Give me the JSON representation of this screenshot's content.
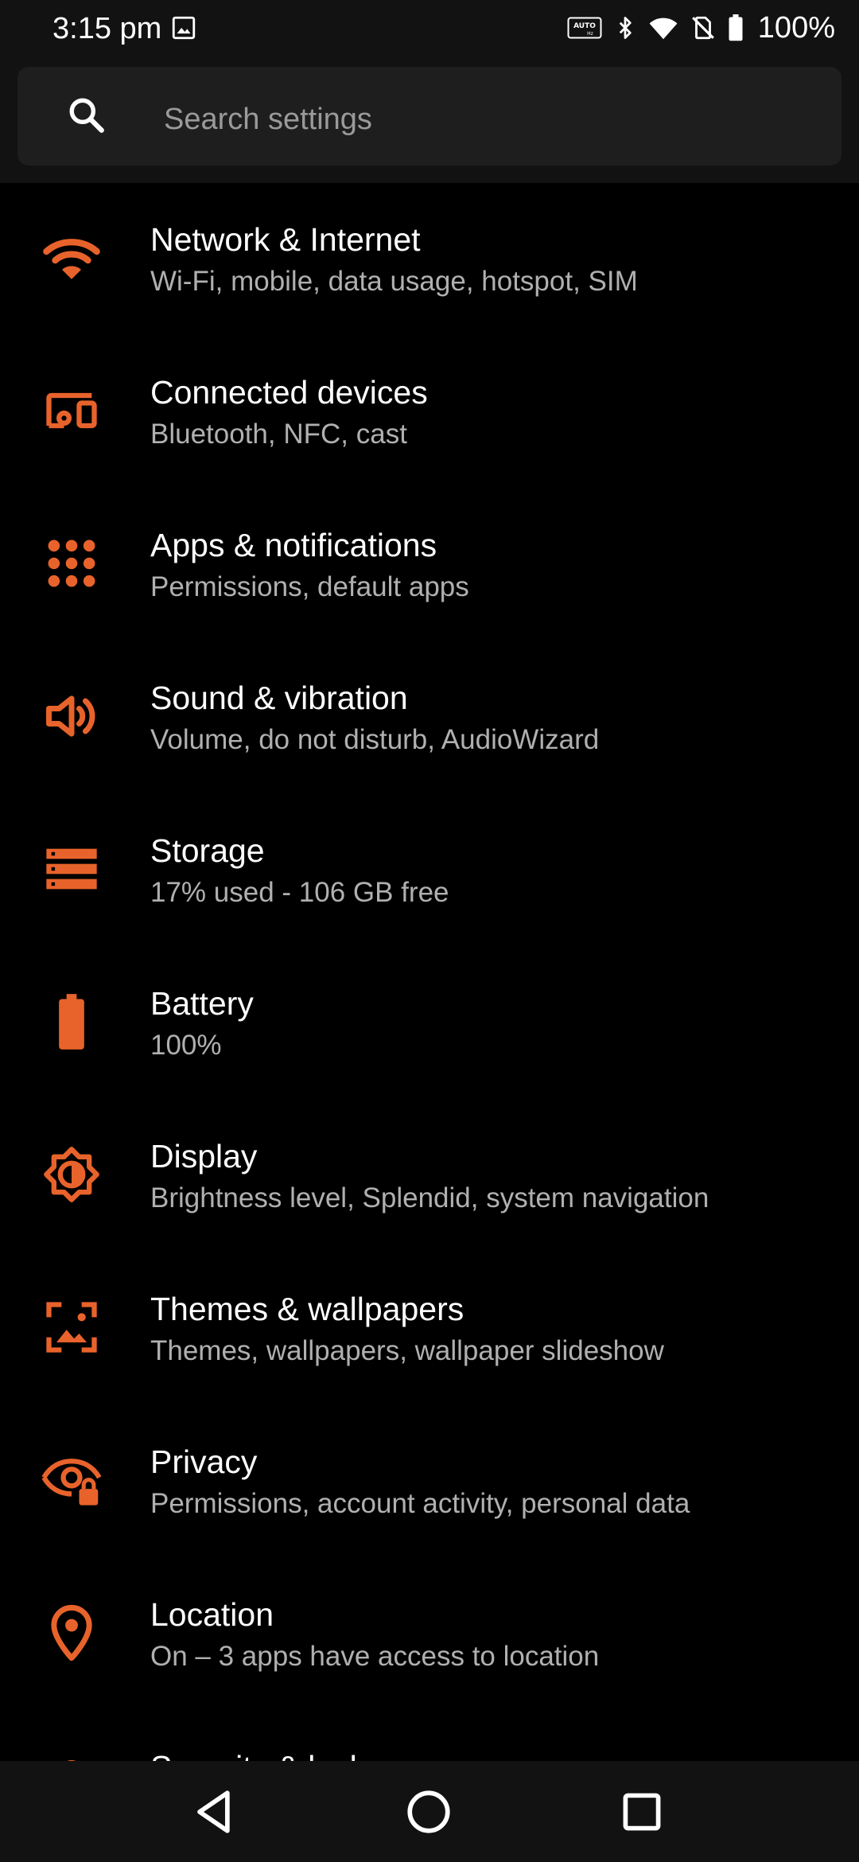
{
  "status_bar": {
    "time": "3:15 pm",
    "battery_percent": "100%",
    "icons": [
      "gallery-icon",
      "auto-hz-icon",
      "bluetooth-icon",
      "wifi-icon",
      "no-sim-icon",
      "battery-icon"
    ],
    "auto_badge_text": "AUTO"
  },
  "search": {
    "placeholder": "Search settings"
  },
  "accent_color": "#e8632b",
  "settings": [
    {
      "icon": "wifi-icon",
      "title": "Network & Internet",
      "subtitle": "Wi-Fi, mobile, data usage, hotspot, SIM"
    },
    {
      "icon": "devices-icon",
      "title": "Connected devices",
      "subtitle": "Bluetooth, NFC, cast"
    },
    {
      "icon": "apps-grid-icon",
      "title": "Apps & notifications",
      "subtitle": "Permissions, default apps"
    },
    {
      "icon": "speaker-icon",
      "title": "Sound & vibration",
      "subtitle": "Volume, do not disturb, AudioWizard"
    },
    {
      "icon": "storage-icon",
      "title": "Storage",
      "subtitle": "17% used - 106 GB free"
    },
    {
      "icon": "battery-icon",
      "title": "Battery",
      "subtitle": "100%"
    },
    {
      "icon": "brightness-icon",
      "title": "Display",
      "subtitle": "Brightness level, Splendid, system navigation"
    },
    {
      "icon": "wallpaper-icon",
      "title": "Themes & wallpapers",
      "subtitle": "Themes, wallpapers, wallpaper slideshow"
    },
    {
      "icon": "privacy-eye-icon",
      "title": "Privacy",
      "subtitle": "Permissions, account activity, personal data"
    },
    {
      "icon": "location-pin-icon",
      "title": "Location",
      "subtitle": "On – 3 apps have access to location"
    },
    {
      "icon": "security-lock-icon",
      "title": "Security & lock",
      "subtitle": ""
    }
  ],
  "nav_bar": {
    "buttons": [
      "back-icon",
      "home-icon",
      "recents-icon"
    ]
  }
}
